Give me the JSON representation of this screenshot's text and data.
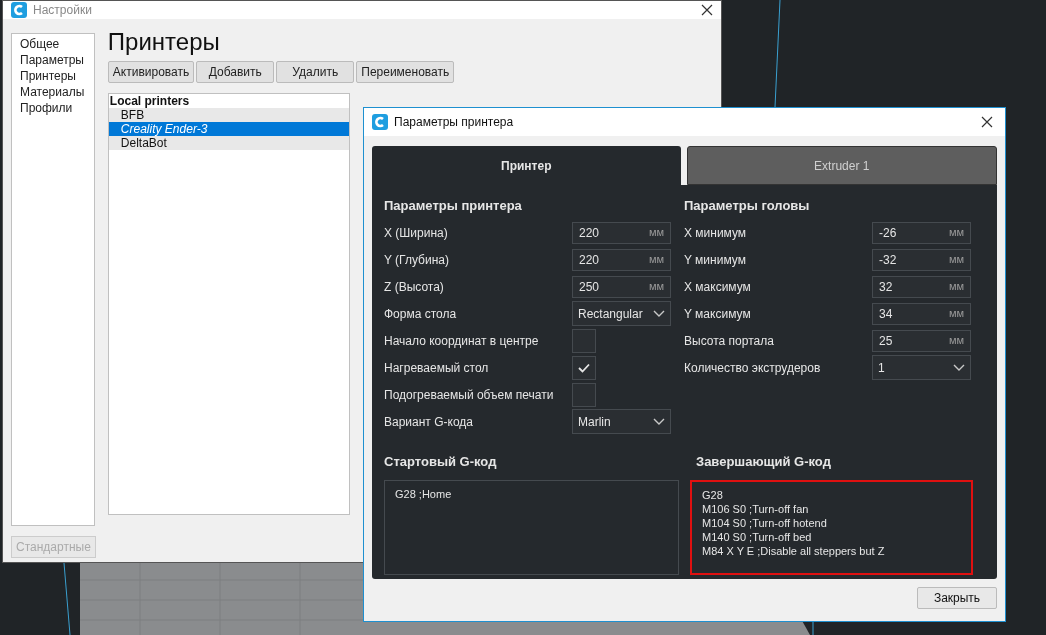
{
  "settings_window": {
    "title": "Настройки",
    "sidebar": {
      "items": [
        {
          "label": "Общее",
          "selected": false
        },
        {
          "label": "Параметры",
          "selected": false
        },
        {
          "label": "Принтеры",
          "selected": false
        },
        {
          "label": "Материалы",
          "selected": false
        },
        {
          "label": "Профили",
          "selected": false
        }
      ]
    },
    "heading": "Принтеры",
    "toolbar": [
      {
        "label": "Активировать",
        "disabled": false
      },
      {
        "label": "Добавить",
        "disabled": false
      },
      {
        "label": "Удалить",
        "disabled": false
      },
      {
        "label": "Переименовать",
        "disabled": false
      }
    ],
    "printer_list": {
      "group": "Local printers",
      "items": [
        {
          "name": "BFB",
          "selected": false,
          "active": false
        },
        {
          "name": "Creality Ender-3",
          "selected": true,
          "active": true
        },
        {
          "name": "DeltaBot",
          "selected": false,
          "active": false
        }
      ]
    },
    "defaults_button": {
      "label": "Стандартные",
      "disabled": true
    }
  },
  "dialog": {
    "title": "Параметры принтера",
    "tabs": [
      {
        "label": "Принтер",
        "selected": true
      },
      {
        "label": "Extruder 1",
        "selected": false
      }
    ],
    "sections": [
      {
        "title": "Параметры принтера",
        "fields": [
          {
            "kind": "number",
            "label": "X (Ширина)",
            "value": "220",
            "unit": "мм"
          },
          {
            "kind": "number",
            "label": "Y (Глубина)",
            "value": "220",
            "unit": "мм"
          },
          {
            "kind": "number",
            "label": "Z (Высота)",
            "value": "250",
            "unit": "мм"
          },
          {
            "kind": "dropdown",
            "label": "Форма стола",
            "value": "Rectangular"
          },
          {
            "kind": "checkbox",
            "label": "Начало координат в центре",
            "checked": false
          },
          {
            "kind": "checkbox",
            "label": "Нагреваемый стол",
            "checked": true
          },
          {
            "kind": "checkbox",
            "label": "Подогреваемый объем печати",
            "checked": false
          },
          {
            "kind": "dropdown",
            "label": "Вариант G-кода",
            "value": "Marlin"
          }
        ]
      },
      {
        "title": "Параметры головы",
        "fields": [
          {
            "kind": "number",
            "label": "X минимум",
            "value": "-26",
            "unit": "мм"
          },
          {
            "kind": "number",
            "label": "Y минимум",
            "value": "-32",
            "unit": "мм"
          },
          {
            "kind": "number",
            "label": "X максимум",
            "value": "32",
            "unit": "мм"
          },
          {
            "kind": "number",
            "label": "Y максимум",
            "value": "34",
            "unit": "мм"
          },
          {
            "kind": "number",
            "label": "Высота портала",
            "value": "25",
            "unit": "мм"
          },
          {
            "kind": "dropdown",
            "label": "Количество экструдеров",
            "value": "1"
          }
        ]
      }
    ],
    "gcode": [
      {
        "title": "Стартовый G-код",
        "highlighted": false,
        "lines": [
          "G28 ;Home"
        ]
      },
      {
        "title": "Завершающий G-код",
        "highlighted": true,
        "lines": [
          "G28",
          "M106 S0 ;Turn-off fan",
          "M104 S0 ;Turn-off hotend",
          "M140 S0 ;Turn-off bed",
          "M84 X Y E ;Disable all steppers but Z"
        ]
      }
    ],
    "close_button": "Закрыть"
  }
}
